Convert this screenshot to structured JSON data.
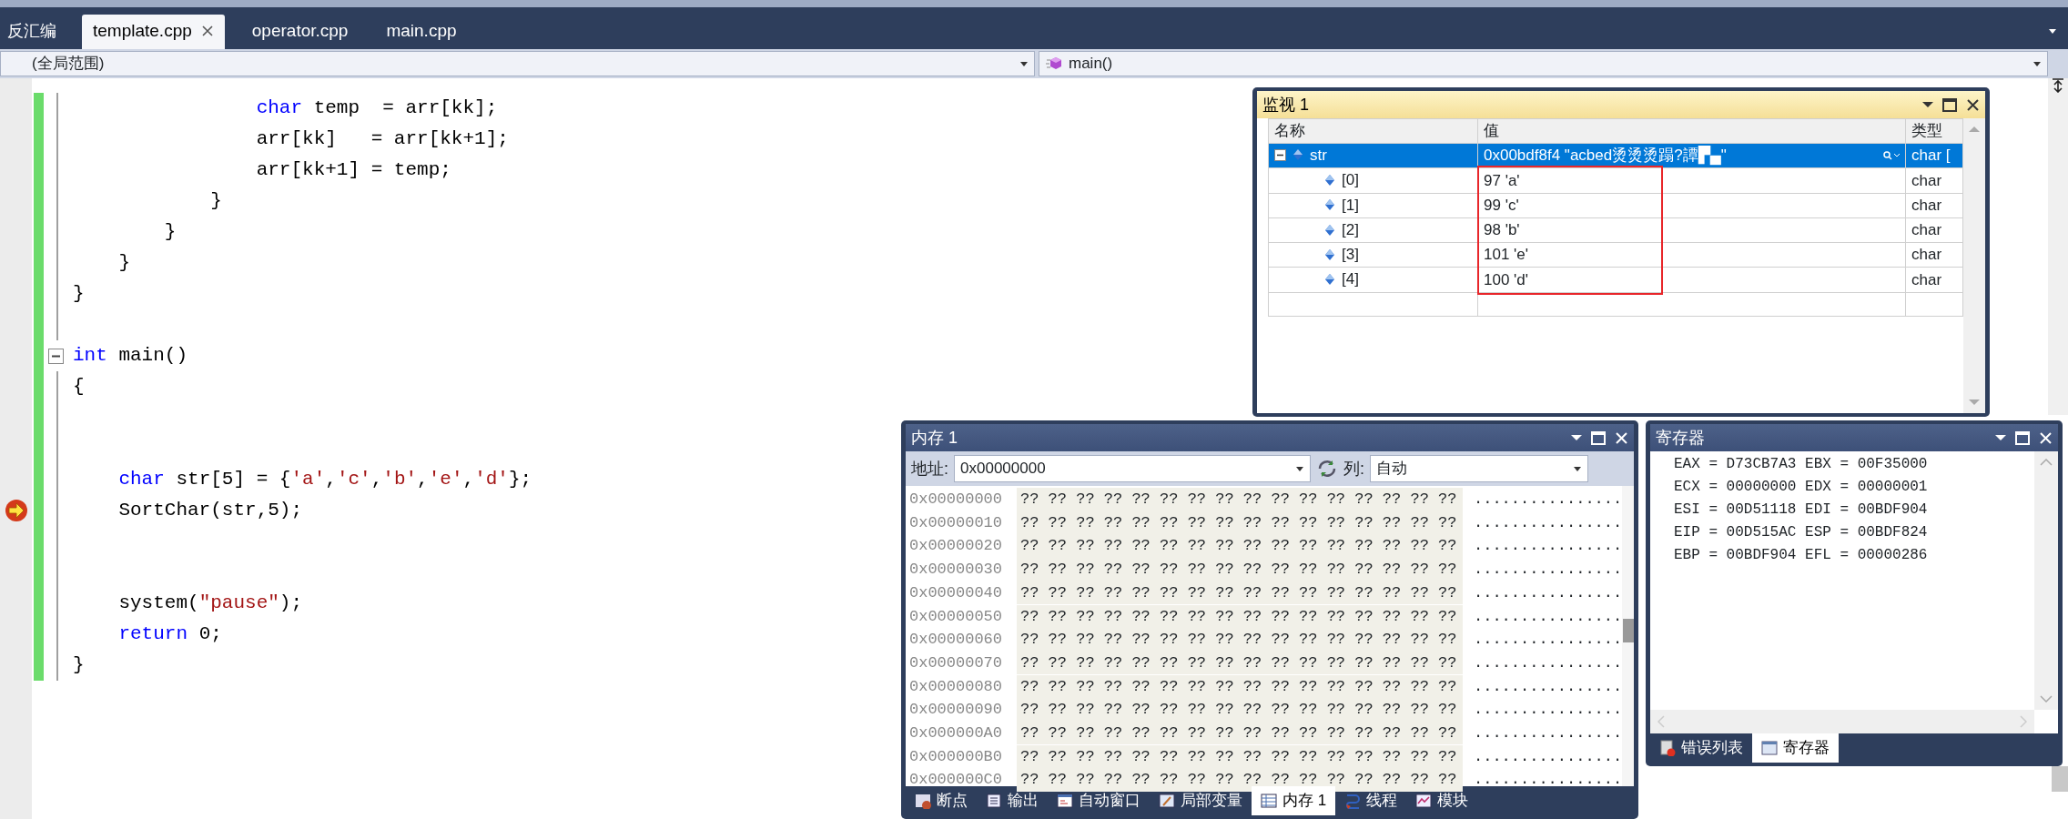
{
  "toolbar_label": "反汇编",
  "tabs": [
    {
      "label": "template.cpp",
      "selected": true
    },
    {
      "label": "operator.cpp",
      "selected": false
    },
    {
      "label": "main.cpp",
      "selected": false
    }
  ],
  "scope_bar": {
    "scope": "(全局范围)",
    "function": "main()"
  },
  "editor": {
    "lines": [
      {
        "current": false,
        "tokens": [
          {
            "text": "                char",
            "kind": "keyword"
          },
          {
            "text": " temp  = arr[kk];",
            "kind": "plain"
          }
        ]
      },
      {
        "current": false,
        "tokens": [
          {
            "text": "                arr[kk]   = arr[kk+1];",
            "kind": "plain"
          }
        ]
      },
      {
        "current": false,
        "tokens": [
          {
            "text": "                arr[kk+1] = temp;",
            "kind": "plain"
          }
        ]
      },
      {
        "current": false,
        "tokens": [
          {
            "text": "            }",
            "kind": "plain"
          }
        ]
      },
      {
        "current": false,
        "tokens": [
          {
            "text": "        }",
            "kind": "plain"
          }
        ]
      },
      {
        "current": false,
        "tokens": [
          {
            "text": "    }",
            "kind": "plain"
          }
        ]
      },
      {
        "current": false,
        "tokens": [
          {
            "text": "}",
            "kind": "plain"
          }
        ]
      },
      {
        "current": false
      },
      {
        "current": false,
        "fold_expanded": true,
        "tokens": [
          {
            "text": "int",
            "kind": "keyword"
          },
          {
            "text": " main()",
            "kind": "plain"
          }
        ]
      },
      {
        "current": false,
        "tokens": [
          {
            "text": "{",
            "kind": "plain"
          }
        ]
      },
      {
        "current": false
      },
      {
        "current": false
      },
      {
        "current": false,
        "tokens": [
          {
            "text": "    char",
            "kind": "keyword"
          },
          {
            "text": " str[5] = {",
            "kind": "plain"
          },
          {
            "text": "'a'",
            "kind": "string"
          },
          {
            "text": ",",
            "kind": "plain"
          },
          {
            "text": "'c'",
            "kind": "string"
          },
          {
            "text": ",",
            "kind": "plain"
          },
          {
            "text": "'b'",
            "kind": "string"
          },
          {
            "text": ",",
            "kind": "plain"
          },
          {
            "text": "'e'",
            "kind": "string"
          },
          {
            "text": ",",
            "kind": "plain"
          },
          {
            "text": "'d'",
            "kind": "string"
          },
          {
            "text": "};",
            "kind": "plain"
          }
        ]
      },
      {
        "current": true,
        "tokens": [
          {
            "text": "    SortChar(str,5);",
            "kind": "plain"
          }
        ]
      },
      {
        "current": false
      },
      {
        "current": false
      },
      {
        "current": false,
        "tokens": [
          {
            "text": "    system(",
            "kind": "plain"
          },
          {
            "text": "\"pause\"",
            "kind": "string"
          },
          {
            "text": ");",
            "kind": "plain"
          }
        ]
      },
      {
        "current": false,
        "tokens": [
          {
            "text": "    return",
            "kind": "keyword"
          },
          {
            "text": " 0;",
            "kind": "plain"
          }
        ]
      },
      {
        "current": false,
        "tokens": [
          {
            "text": "}",
            "kind": "plain"
          }
        ]
      }
    ]
  },
  "watch_window": {
    "title": "监视 1",
    "columns": [
      "名称",
      "值",
      "类型"
    ],
    "rows": [
      {
        "name": "str",
        "value": "0x00bdf8f4 \"acbed烫烫烫蹋?譚▛▄\"",
        "type": "char [",
        "selected": true,
        "expanded": true,
        "children": [
          {
            "name": "[0]",
            "value": "97 'a'",
            "type": "char",
            "selected": false
          },
          {
            "name": "[1]",
            "value": "99 'c'",
            "type": "char",
            "selected": false
          },
          {
            "name": "[2]",
            "value": "98 'b'",
            "type": "char",
            "selected": false
          },
          {
            "name": "[3]",
            "value": "101 'e'",
            "type": "char",
            "selected": false
          },
          {
            "name": "[4]",
            "value": "100 'd'",
            "type": "char",
            "selected": false
          }
        ]
      }
    ],
    "child_values_boxed": true
  },
  "memory_window": {
    "title": "内存 1",
    "address_label": "地址:",
    "address": "0x00000000",
    "columns_label": "列:",
    "columns": "自动",
    "rows": [
      {
        "address": "0x00000000",
        "bytes": "?? ?? ?? ?? ?? ?? ?? ?? ?? ?? ?? ?? ?? ?? ?? ??",
        "text": "................"
      },
      {
        "address": "0x00000010",
        "bytes": "?? ?? ?? ?? ?? ?? ?? ?? ?? ?? ?? ?? ?? ?? ?? ??",
        "text": "................"
      },
      {
        "address": "0x00000020",
        "bytes": "?? ?? ?? ?? ?? ?? ?? ?? ?? ?? ?? ?? ?? ?? ?? ??",
        "text": "................"
      },
      {
        "address": "0x00000030",
        "bytes": "?? ?? ?? ?? ?? ?? ?? ?? ?? ?? ?? ?? ?? ?? ?? ??",
        "text": "................"
      },
      {
        "address": "0x00000040",
        "bytes": "?? ?? ?? ?? ?? ?? ?? ?? ?? ?? ?? ?? ?? ?? ?? ??",
        "text": "................"
      },
      {
        "address": "0x00000050",
        "bytes": "?? ?? ?? ?? ?? ?? ?? ?? ?? ?? ?? ?? ?? ?? ?? ??",
        "text": "................"
      },
      {
        "address": "0x00000060",
        "bytes": "?? ?? ?? ?? ?? ?? ?? ?? ?? ?? ?? ?? ?? ?? ?? ??",
        "text": "................"
      },
      {
        "address": "0x00000070",
        "bytes": "?? ?? ?? ?? ?? ?? ?? ?? ?? ?? ?? ?? ?? ?? ?? ??",
        "text": "................"
      },
      {
        "address": "0x00000080",
        "bytes": "?? ?? ?? ?? ?? ?? ?? ?? ?? ?? ?? ?? ?? ?? ?? ??",
        "text": "................"
      },
      {
        "address": "0x00000090",
        "bytes": "?? ?? ?? ?? ?? ?? ?? ?? ?? ?? ?? ?? ?? ?? ?? ??",
        "text": "................"
      },
      {
        "address": "0x000000A0",
        "bytes": "?? ?? ?? ?? ?? ?? ?? ?? ?? ?? ?? ?? ?? ?? ?? ??",
        "text": "................"
      },
      {
        "address": "0x000000B0",
        "bytes": "?? ?? ?? ?? ?? ?? ?? ?? ?? ?? ?? ?? ?? ?? ?? ??",
        "text": "................"
      },
      {
        "address": "0x000000C0",
        "bytes": "?? ?? ?? ?? ?? ?? ?? ?? ?? ?? ?? ?? ?? ?? ?? ??",
        "text": "................"
      }
    ],
    "tabs": [
      {
        "label": "断点",
        "selected": false
      },
      {
        "label": "输出",
        "selected": false
      },
      {
        "label": "自动窗口",
        "selected": false
      },
      {
        "label": "局部变量",
        "selected": false
      },
      {
        "label": "内存 1",
        "selected": true
      },
      {
        "label": "线程",
        "selected": false
      },
      {
        "label": "模块",
        "selected": false
      }
    ]
  },
  "registers_window": {
    "title": "寄存器",
    "lines": [
      "EAX = D73CB7A3 EBX = 00F35000",
      "ECX = 00000000 EDX = 00000001",
      "ESI = 00D51118 EDI = 00BDF904",
      "EIP = 00D515AC ESP = 00BDF824",
      "EBP = 00BDF904 EFL = 00000286"
    ],
    "tabs": [
      {
        "label": "错误列表",
        "selected": false
      },
      {
        "label": "寄存器",
        "selected": true
      }
    ]
  }
}
